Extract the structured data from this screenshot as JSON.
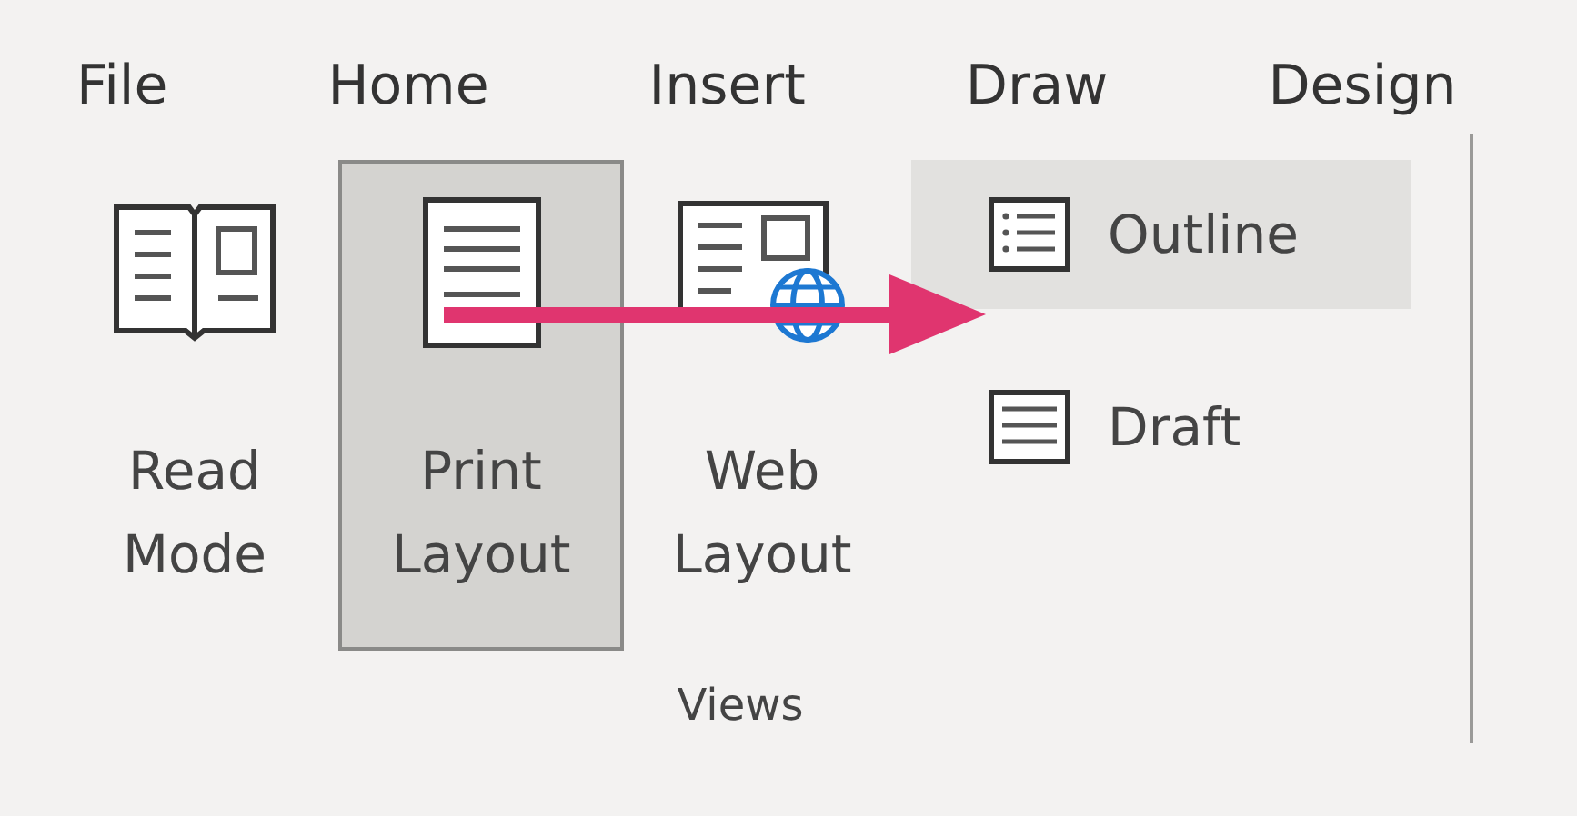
{
  "menu": [
    {
      "label": "File"
    },
    {
      "label": "Home"
    },
    {
      "label": "Insert"
    },
    {
      "label": "Draw"
    },
    {
      "label": "Design"
    }
  ],
  "views_group": {
    "label": "Views",
    "large_buttons": [
      {
        "kind": "read",
        "lines": [
          "Read",
          "Mode"
        ],
        "selected": false
      },
      {
        "kind": "print",
        "lines": [
          "Print",
          "Layout"
        ],
        "selected": true
      },
      {
        "kind": "web",
        "lines": [
          "Web",
          "Layout"
        ],
        "selected": false
      }
    ],
    "small_buttons": [
      {
        "kind": "outline",
        "label": "Outline",
        "selected": true
      },
      {
        "kind": "draft",
        "label": "Draft",
        "selected": false
      }
    ]
  },
  "annotation": {
    "kind": "arrow",
    "color": "#e0356f"
  }
}
